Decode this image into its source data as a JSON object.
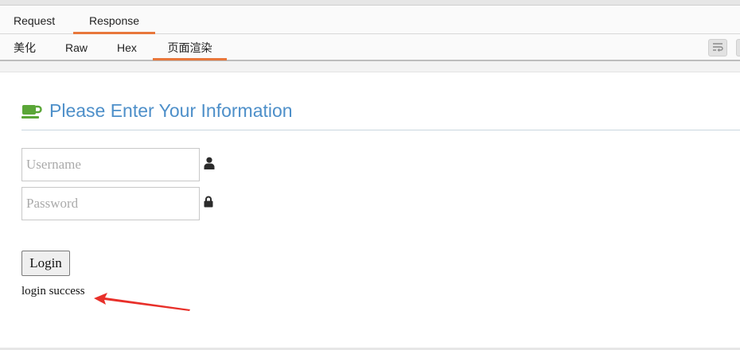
{
  "main_tabs": [
    {
      "label": "Request",
      "active": false
    },
    {
      "label": "Response",
      "active": true
    }
  ],
  "sub_tabs": [
    {
      "label": "美化",
      "active": false
    },
    {
      "label": "Raw",
      "active": false
    },
    {
      "label": "Hex",
      "active": false
    },
    {
      "label": "页面渲染",
      "active": true
    }
  ],
  "toolbar": {
    "wrap_icon": "wrap-lines-icon"
  },
  "page": {
    "heading_icon": "coffee-cup-icon",
    "heading": "Please Enter Your Information",
    "username_placeholder": "Username",
    "username_icon": "user-icon",
    "password_placeholder": "Password",
    "password_icon": "lock-icon",
    "login_label": "Login",
    "status_message": "login success"
  },
  "colors": {
    "active_tab_underline": "#e8773b",
    "heading": "#4d8fc9",
    "cup_icon": "#5aa637",
    "annotation_arrow": "#e8302a"
  }
}
